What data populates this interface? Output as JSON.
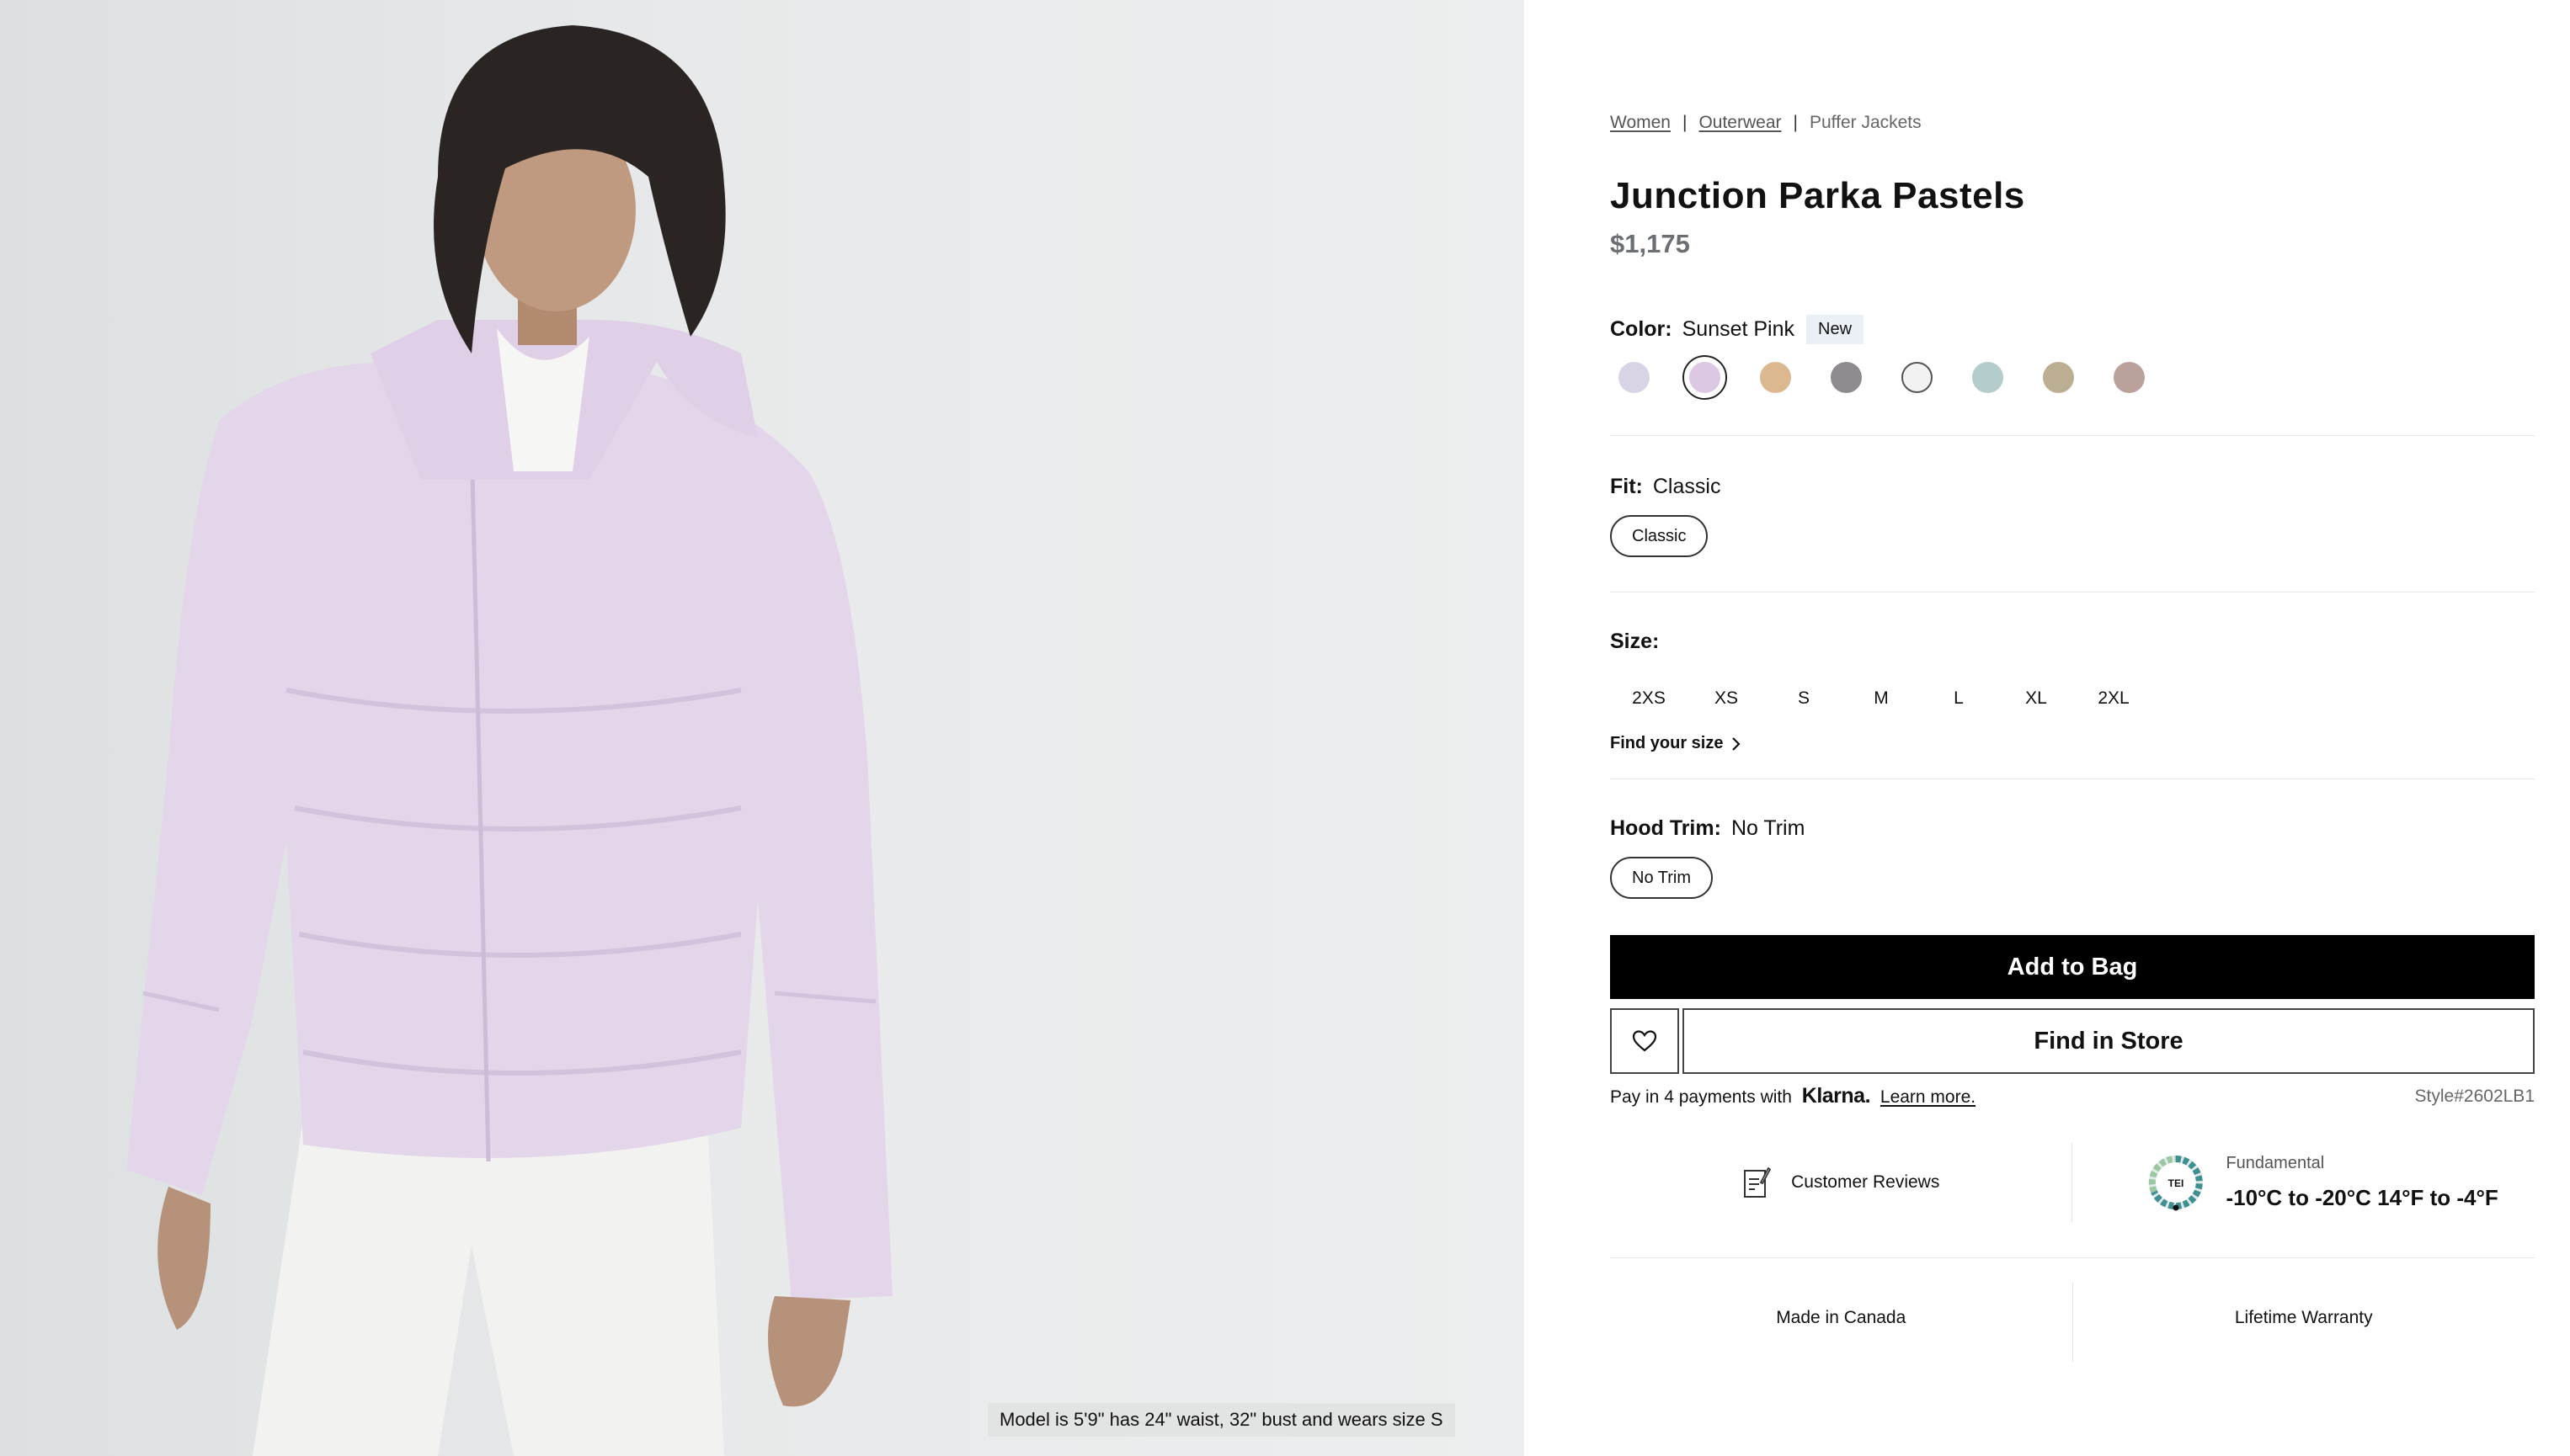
{
  "hero": {
    "model_caption": "Model is 5'9\" has 24\" waist, 32\" bust and wears size S"
  },
  "breadcrumb": {
    "items": [
      "Women",
      "Outerwear",
      "Puffer Jackets"
    ],
    "separator": "|"
  },
  "product": {
    "title": "Junction Parka Pastels",
    "price": "$1,175"
  },
  "color": {
    "label": "Color:",
    "selected": "Sunset Pink",
    "badge": "New",
    "swatches": [
      {
        "hex": "#d8d4e6",
        "selected": false
      },
      {
        "hex": "#dcc8e2",
        "selected": true
      },
      {
        "hex": "#dcb890",
        "selected": false
      },
      {
        "hex": "#8e8a8e",
        "selected": false
      },
      {
        "hex": "#f2f2f2",
        "selected": false
      },
      {
        "hex": "#b4cccb",
        "selected": false
      },
      {
        "hex": "#bcae90",
        "selected": false
      },
      {
        "hex": "#baa19c",
        "selected": false
      }
    ]
  },
  "fit": {
    "label": "Fit:",
    "selected": "Classic",
    "option": "Classic"
  },
  "size": {
    "label": "Size:",
    "options": [
      "2XS",
      "XS",
      "S",
      "M",
      "L",
      "XL",
      "2XL"
    ],
    "find_link": "Find your size"
  },
  "hood": {
    "label": "Hood Trim:",
    "selected": "No Trim",
    "option": "No Trim"
  },
  "actions": {
    "add_to_bag": "Add to Bag",
    "find_in_store": "Find in Store"
  },
  "payment": {
    "prefix": "Pay in 4 payments with",
    "brand": "Klarna.",
    "learn_more": "Learn more.",
    "style": "Style#2602LB1"
  },
  "features": {
    "reviews": "Customer Reviews",
    "tei_badge": "TEI",
    "tei_label": "Fundamental",
    "tei_range": "-10°C to -20°C 14°F to -4°F",
    "made_in": "Made in Canada",
    "warranty": "Lifetime Warranty"
  },
  "colors": {
    "jacket": "#e3d6ea",
    "add_to_bag_bg": "#000000"
  }
}
